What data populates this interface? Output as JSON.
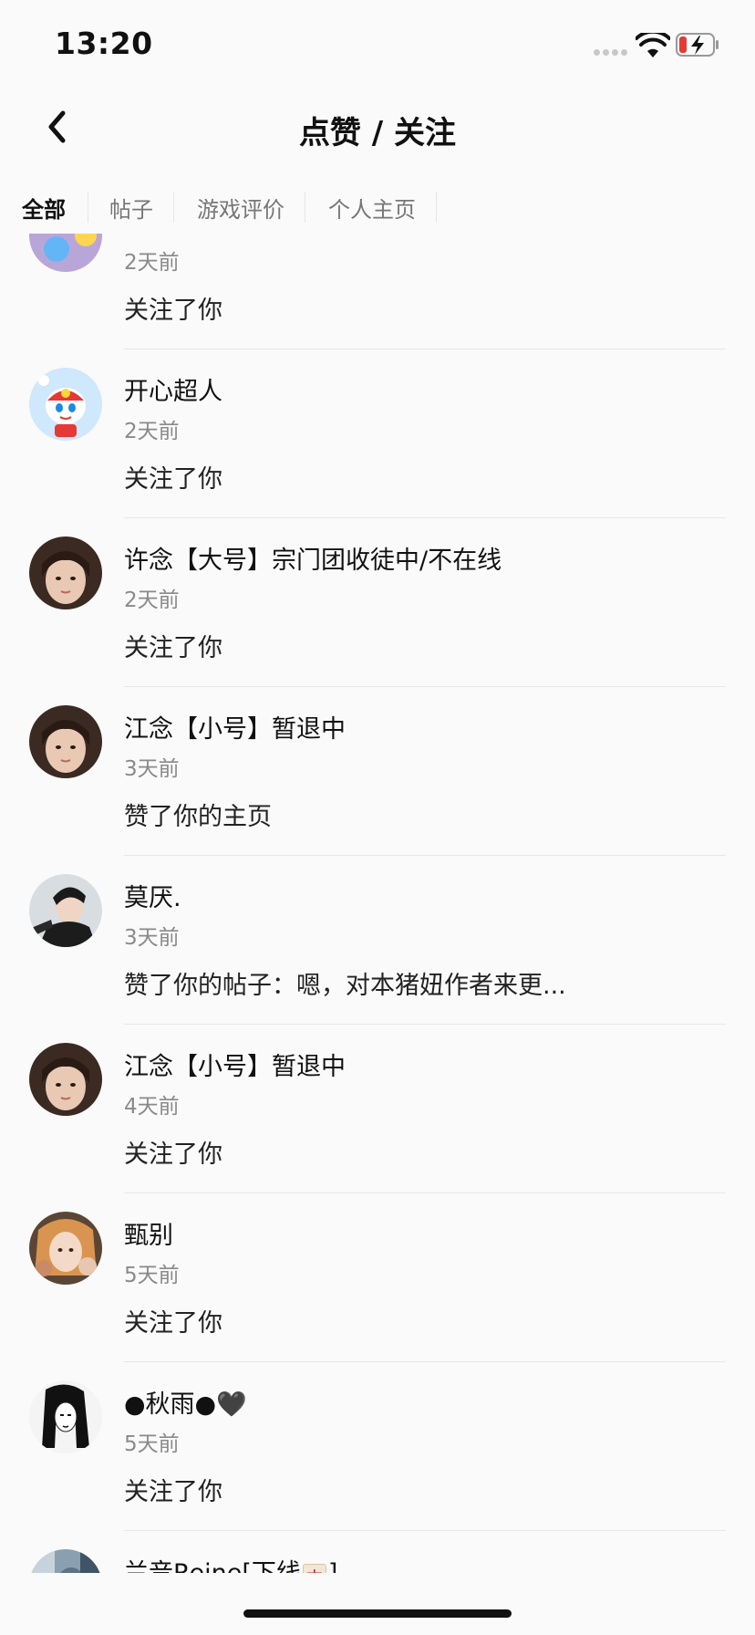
{
  "status_bar": {
    "time": "13:20",
    "icons": [
      "cellular-signal-icon",
      "wifi-icon",
      "battery-charging-icon"
    ]
  },
  "nav": {
    "back_icon": "chevron-left-icon",
    "title": "点赞 / 关注"
  },
  "tabs": [
    {
      "label": "全部",
      "active": true
    },
    {
      "label": "帖子",
      "active": false
    },
    {
      "label": "游戏评价",
      "active": false
    },
    {
      "label": "个人主页",
      "active": false
    }
  ],
  "notifications": [
    {
      "name": "",
      "time": "2天前",
      "action": "关注了你"
    },
    {
      "name": "开心超人",
      "time": "2天前",
      "action": "关注了你"
    },
    {
      "name": "许念【大号】宗门团收徒中/不在线",
      "time": "2天前",
      "action": "关注了你"
    },
    {
      "name": "江念【小号】暂退中",
      "time": "3天前",
      "action": "赞了你的主页"
    },
    {
      "name": "莫厌.",
      "time": "3天前",
      "action": "赞了你的帖子：嗯，对本猪妞作者来更..."
    },
    {
      "name": "江念【小号】暂退中",
      "time": "4天前",
      "action": "关注了你"
    },
    {
      "name": "甄别",
      "time": "5天前",
      "action": "关注了你"
    },
    {
      "name": "●秋雨●🖤",
      "time": "5天前",
      "action": "关注了你"
    },
    {
      "name_prefix": "兰音Reine[下线",
      "name_tile": "中",
      "name_suffix": "]",
      "time": "",
      "action": ""
    }
  ],
  "colors": {
    "background": "#fafafa",
    "text_primary": "#111111",
    "text_secondary": "#8a8a8a",
    "divider": "#e7e7e7",
    "battery_low": "#e53935"
  }
}
